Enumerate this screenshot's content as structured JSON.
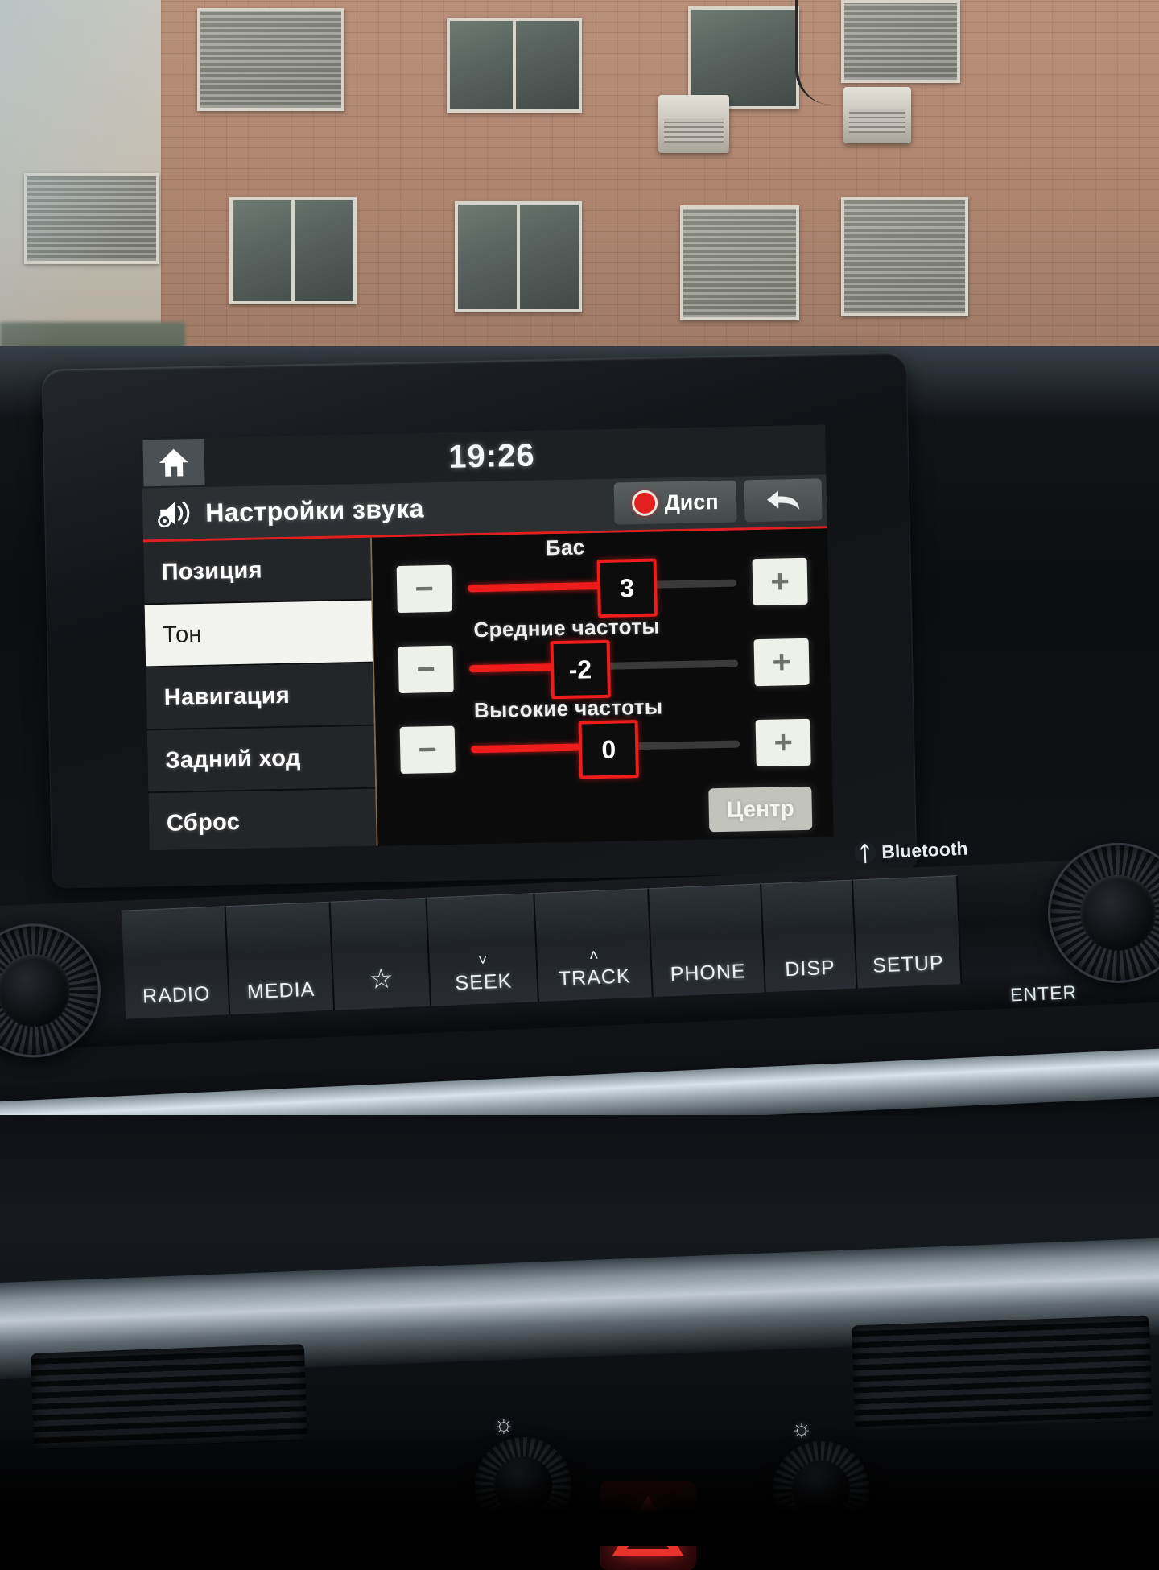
{
  "head_unit": {
    "status_bar": {
      "home_icon": "home-icon",
      "clock": "19:26"
    },
    "title_bar": {
      "icon": "speaker-settings-icon",
      "title": "Настройки звука",
      "disp_button": {
        "label": "Дисп",
        "indicator_icon": "red-record-dot-icon",
        "indicator_color": "#e41f1f"
      },
      "back_button_icon": "back-arrow-icon",
      "accent_color": "#e02020"
    },
    "sidebar": {
      "items": [
        {
          "label": "Позиция",
          "selected": false
        },
        {
          "label": "Тон",
          "selected": true
        },
        {
          "label": "Навигация",
          "selected": false
        },
        {
          "label": "Задний ход",
          "selected": false
        },
        {
          "label": "Сброс",
          "selected": false
        }
      ]
    },
    "tone_panel": {
      "sliders": [
        {
          "label": "Бас",
          "value": "3",
          "fill_percent": 58,
          "minus_label": "−",
          "plus_label": "+"
        },
        {
          "label": "Средние частоты",
          "value": "-2",
          "fill_percent": 40,
          "minus_label": "−",
          "plus_label": "+"
        },
        {
          "label": "Высокие частоты",
          "value": "0",
          "fill_percent": 50,
          "minus_label": "−",
          "plus_label": "+"
        }
      ],
      "center_button": "Центр"
    }
  },
  "hard_controls": {
    "bluetooth_label": "Bluetooth",
    "bluetooth_icon": "bluetooth-icon",
    "enter_label": "ENTER",
    "buttons": [
      {
        "label": "RADIO",
        "icon": null
      },
      {
        "label": "MEDIA",
        "icon": null
      },
      {
        "label": "",
        "icon": "star-icon"
      },
      {
        "label": "SEEK",
        "icon": "chevron-down-icon"
      },
      {
        "label": "TRACK",
        "icon": "chevron-up-icon"
      },
      {
        "label": "PHONE",
        "icon": null
      },
      {
        "label": "DISP",
        "icon": null
      },
      {
        "label": "SETUP",
        "icon": null
      }
    ],
    "left_knob": "volume-power-knob",
    "right_knob": "tune-enter-knob"
  },
  "climate": {
    "left_seat_heater_icon": "seat-heater-icon",
    "right_seat_heater_icon": "seat-heater-icon",
    "hazard_icon": "hazard-triangle-icon",
    "hazard_color": "#e8322a"
  }
}
